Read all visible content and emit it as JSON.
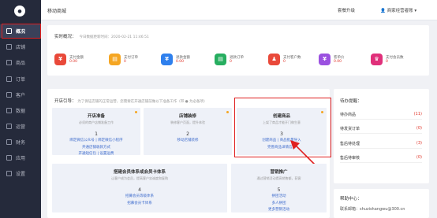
{
  "sidebar": {
    "logo_glyph": "●",
    "items": [
      {
        "label": "概况",
        "active": true
      },
      {
        "label": "店铺"
      },
      {
        "label": "商品"
      },
      {
        "label": "订单"
      },
      {
        "label": "客户"
      },
      {
        "label": "数据"
      },
      {
        "label": "运营"
      },
      {
        "label": "财务"
      },
      {
        "label": "应用"
      },
      {
        "label": "设置"
      }
    ]
  },
  "topbar": {
    "title": "移动商城",
    "upgrade": "套餐升级",
    "user": "👤 商家经营者账 ▾"
  },
  "overview": {
    "title": "实时概况：",
    "subtitle": "今日数据更新时间：2020-02-21 11:46:51",
    "stats": [
      {
        "label": "支付金额",
        "value": "0.00",
        "color": "#e9493a",
        "glyph": "¥"
      },
      {
        "label": "支付订单",
        "value": "0",
        "color": "#f5a623",
        "glyph": "▤"
      },
      {
        "label": "退款金额",
        "value": "0.00",
        "color": "#2f80ed",
        "glyph": "¥"
      },
      {
        "label": "退款订单",
        "value": "0",
        "color": "#27ae60",
        "glyph": "▤"
      },
      {
        "label": "支付客户数",
        "value": "0",
        "color": "#e9493a",
        "glyph": "♟"
      },
      {
        "label": "客单价",
        "value": "0.00",
        "color": "#9b51e0",
        "glyph": "¥"
      },
      {
        "label": "支付会员数",
        "value": "0",
        "color": "#e0307a",
        "glyph": "♛"
      }
    ]
  },
  "guide": {
    "title": "开店引导：",
    "subtitle": "为了保证店铺的正常运营，您需要在开通店铺前做以下准备工作（带 ● 为必备项）",
    "cards": [
      {
        "title": "开店准备",
        "desc": "必须的商户店铺准备工作",
        "num": "1",
        "links": [
          "绑定微信公众号 | 绑定微信小程序",
          "开通店铺收款方式",
          "开通短信包 | 设置运费"
        ]
      },
      {
        "title": "店铺装修",
        "desc": "装修客户页面，提升体验",
        "num": "2",
        "links": [
          "移动店铺装修"
        ]
      },
      {
        "title": "创建商品",
        "desc": "上架了商品才能开门做生意",
        "num": "3",
        "links": [
          "创建商品 | 商品批量导入",
          "完善商品详情信息"
        ]
      },
      {
        "title": "搭建会员体系或会员卡体系",
        "desc": "让客户成为会员，提高客户忠诚度和复购",
        "num": "4",
        "links": [
          "招募会员等级体系",
          "招募会员卡体系"
        ]
      },
      {
        "title": "营销推广",
        "desc": "通过营销活动提高销售额，获客",
        "num": "5",
        "links": [
          "拼团活动",
          "多人拼团",
          "更多营销活动"
        ]
      }
    ]
  },
  "todos": {
    "title": "待办提醒：",
    "items": [
      {
        "label": "待办商品",
        "count": "(11)"
      },
      {
        "label": "待发货订单",
        "count": "(0)"
      },
      {
        "label": "售后待处理",
        "count": "(3)"
      },
      {
        "label": "售后待审核",
        "count": "(0)"
      }
    ]
  },
  "help": {
    "title": "帮助中心：",
    "email": "联系邮箱：shuzishangwu@300.cn"
  }
}
